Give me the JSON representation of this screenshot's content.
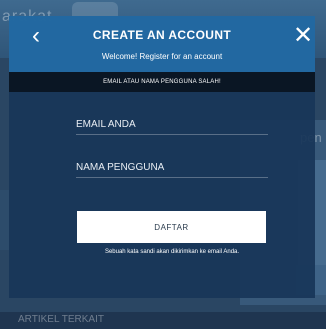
{
  "background": {
    "header_text": "arakat",
    "right_text": "pen",
    "bottom_text": "ARTIKEL TERKAIT"
  },
  "modal": {
    "title": "CREATE AN ACCOUNT",
    "subtitle": "Welcome! Register for an account",
    "back_icon": "chevron-left-icon",
    "close_icon": "close-icon",
    "error_message": "EMAIL ATAU NAMA PENGGUNA SALAH!",
    "email_placeholder": "EMAIL ANDA",
    "email_value": "",
    "username_placeholder": "NAMA PENGGUNA",
    "username_value": "",
    "submit_label": "DAFTAR",
    "info_text": "Sebuah kata sandi akan dikirimkan ke email Anda."
  },
  "colors": {
    "header_blue": "#246ea8",
    "modal_navy": "#183658",
    "error_bar": "#0a1624",
    "button_white": "#ffffff"
  }
}
